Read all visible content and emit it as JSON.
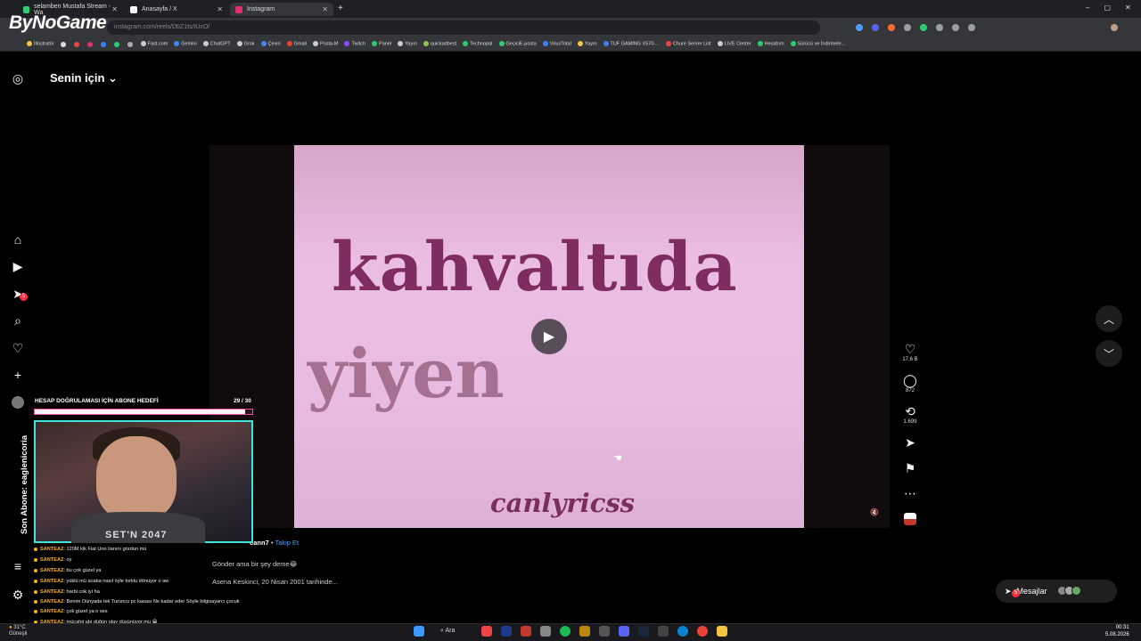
{
  "browser": {
    "tabs": [
      {
        "title": "selamben Mustafa Stream - Wa",
        "color": "#2ecc71"
      },
      {
        "title": "Anasayfa / X",
        "color": "#ffffff"
      },
      {
        "title": "Instagram",
        "color": "#e1306c"
      }
    ],
    "new_tab": "+",
    "url": "instagram.com/reels/DbZ1ts/tUcO/",
    "window_controls": [
      "–",
      "▢",
      "✕"
    ],
    "bookmarks": [
      "İllüstratör",
      "Fast.com",
      "Gemini",
      "ChatGPT",
      "Grok",
      "Çeviri",
      "Gmail",
      "Posta-M",
      "Twitch",
      "Panel",
      "Yayın",
      "quickadbest",
      "Technopat",
      "GeçiciE-posta",
      "VirusTotal",
      "Yayın",
      "TUF GAMING X570-...",
      "Chure Server List",
      "LIVE Center",
      "Hesabım",
      "Sürücü ve İndirmele..."
    ]
  },
  "overlay": {
    "logo": "ByNoGame",
    "goal_title": "HESAP DOĞRULAMASI İÇİN ABONE HEDEFİ",
    "goal_count": "29 / 30",
    "goal_progress": 0.967,
    "last_sub": "Son Abone: eaglenicoria",
    "shirt_text": "SET'N 2047"
  },
  "chat": [
    {
      "user": "SANTEAZ",
      "msg": ": 120M kik Fiat Uno ilanını gördün mü"
    },
    {
      "user": "SANTEAZ",
      "msg": ": oy"
    },
    {
      "user": "SANTEAZ",
      "msg": ": bu çok güzel ya"
    },
    {
      "user": "SANTEAZ",
      "msg": ": yüklü mü acaba nasıl öyle torklu dönüyor o aw"
    },
    {
      "user": "SANTEAZ",
      "msg": ": harbi cok iyi ha"
    },
    {
      "user": "SANTEAZ",
      "msg": ": Benim Dünyada tek Turuncu pc kasası Ne kadar eder Söyle bilgisayarcı çocuk"
    },
    {
      "user": "SANTEAZ",
      "msg": ": çok güzel ya o ses"
    },
    {
      "user": "SANTEAZ",
      "msg": ": mücahit abi düğün olay düşünüyor mu 😁"
    }
  ],
  "instagram": {
    "feed_label": "Senin için",
    "video": {
      "line1": "kahvaltıda",
      "line2": "yiyen",
      "credit": "canlyricss"
    },
    "author": "cann7",
    "follow": "Takip Et",
    "caption": "Gönder ama bir şey deme😂",
    "caption2": "Asena Keskinci, 20 Nisan 2001 tarihinde...",
    "likes": "17,6 B",
    "comments": "872",
    "reposts": "1.699",
    "messages_label": "Mesajlar",
    "messages_badge": "5",
    "notif_badge": "5"
  },
  "taskbar": {
    "search": "Ara",
    "time": "00:31",
    "date": "5.08.2026",
    "weather": "31°C",
    "weather_sub": "Güneşli"
  }
}
